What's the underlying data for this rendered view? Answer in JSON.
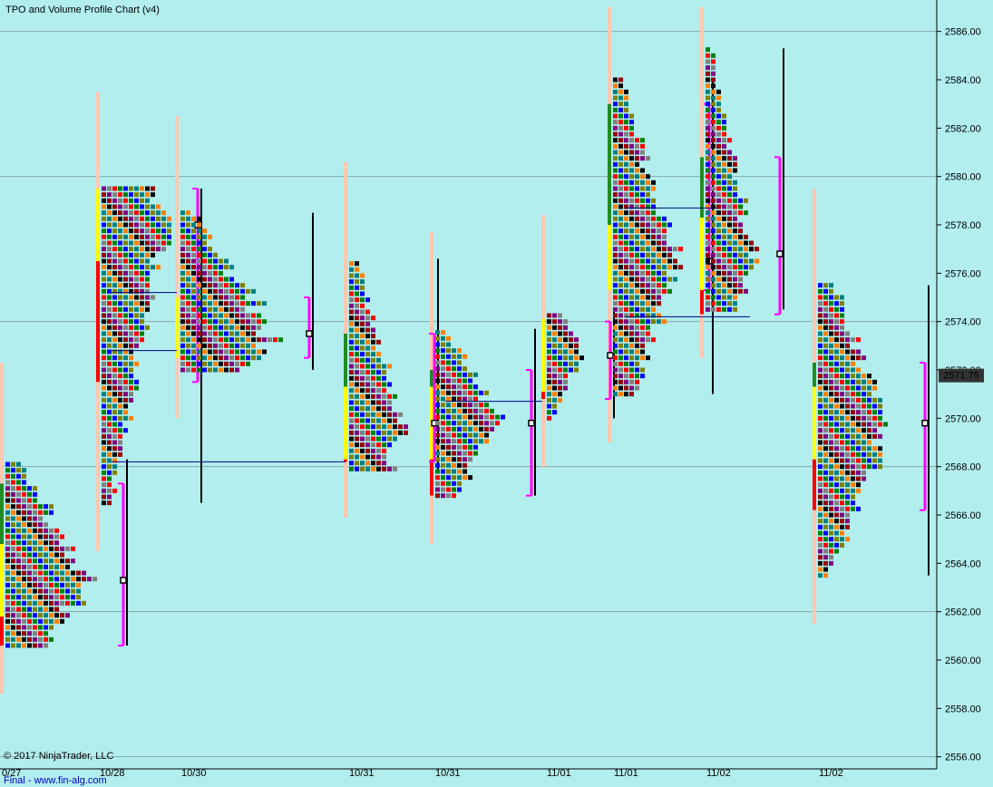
{
  "header": {
    "title": "TPO and Volume Profile Chart (v4)"
  },
  "footer": {
    "copyright": "© 2017 NinjaTrader, LLC",
    "link": "Final - www.fin-alg.com"
  },
  "colors": {
    "background": "#b2eeee",
    "letters": [
      "#ff0000",
      "#008000",
      "#0000ff",
      "#808000",
      "#008080",
      "#ff8000",
      "#000000",
      "#990000",
      "#800080",
      "#808080"
    ]
  },
  "chart_data": {
    "type": "tpo-profile",
    "title": "TPO and Volume Profile Chart (v4)",
    "ylim": [
      2555.5,
      2587.0
    ],
    "y_ticks": [
      "2586.00",
      "2584.00",
      "2582.00",
      "2580.00",
      "2578.00",
      "2576.00",
      "2574.00",
      "2572.00",
      "2570.00",
      "2568.00",
      "2566.00",
      "2564.00",
      "2562.00",
      "2560.00",
      "2558.00",
      "2556.00"
    ],
    "last_price": {
      "label": "2571.75",
      "value": 2571.75
    },
    "x_labels": [
      "0/27",
      "10/28",
      "10/30",
      "10/31",
      "10/31",
      "11/01",
      "11/01",
      "11/02",
      "11/02"
    ],
    "profiles": [
      {
        "low": 2560.6,
        "high": 2568.3,
        "poc": 2563.3,
        "va_low": 2560.6,
        "va_high": 2567.3,
        "max_width": 18
      },
      {
        "low": 2566.5,
        "high": 2579.5,
        "poc": 2578.0,
        "va_low": 2571.5,
        "va_high": 2579.5,
        "max_width": 14
      },
      {
        "low": 2572.0,
        "high": 2578.5,
        "poc": 2573.5,
        "va_low": 2572.5,
        "va_high": 2575.0,
        "max_width": 20
      },
      {
        "low": 2567.9,
        "high": 2576.6,
        "poc": 2569.8,
        "va_low": 2568.2,
        "va_high": 2573.5,
        "max_width": 12
      },
      {
        "low": 2566.8,
        "high": 2573.7,
        "poc": 2569.8,
        "va_low": 2566.8,
        "va_high": 2572.0,
        "max_width": 14
      },
      {
        "low": 2570.0,
        "high": 2574.4,
        "poc": 2572.6,
        "va_low": 2570.8,
        "va_high": 2574.0,
        "max_width": 8
      },
      {
        "low": 2571.0,
        "high": 2584.0,
        "poc": 2576.5,
        "va_low": 2575.3,
        "va_high": 2583.0,
        "max_width": 14
      },
      {
        "low": 2574.5,
        "high": 2585.3,
        "poc": 2576.8,
        "va_low": 2574.3,
        "va_high": 2580.8,
        "max_width": 10
      },
      {
        "low": 2563.5,
        "high": 2575.5,
        "poc": 2569.8,
        "va_low": 2566.2,
        "va_high": 2572.3,
        "max_width": 16
      }
    ],
    "naked_poc_lines": [
      {
        "value": 2575.2,
        "x0": 123,
        "x1": 195
      },
      {
        "value": 2572.8,
        "x0": 123,
        "x1": 195
      },
      {
        "value": 2568.2,
        "x0": 123,
        "x1": 381
      },
      {
        "value": 2570.7,
        "x0": 491,
        "x1": 598
      },
      {
        "value": 2578.7,
        "x0": 689,
        "x1": 790
      },
      {
        "value": 2574.2,
        "x0": 689,
        "x1": 827
      }
    ]
  }
}
